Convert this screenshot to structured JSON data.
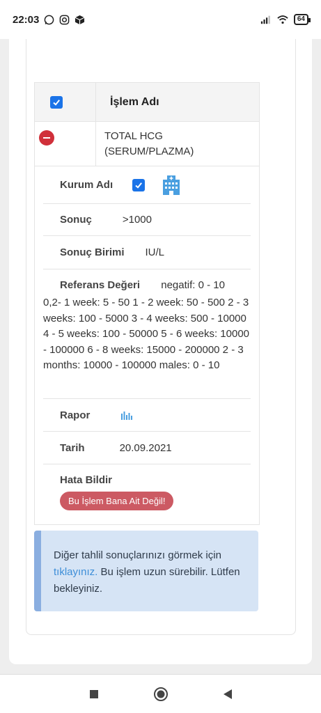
{
  "status_bar": {
    "time": "22:03",
    "battery": "64",
    "left_icons": [
      "whatsapp-icon",
      "instagram-icon",
      "package-icon"
    ],
    "right_icons": [
      "signal-icon",
      "wifi-icon",
      "battery-icon"
    ]
  },
  "table": {
    "header": {
      "name_label": "İşlem Adı"
    },
    "row": {
      "name_line1": "TOTAL HCG",
      "name_line2": "(SERUM/PLAZMA)"
    }
  },
  "details": {
    "kurum_label": "Kurum Adı",
    "sonuc_label": "Sonuç",
    "sonuc_value": ">1000",
    "birim_label": "Sonuç Birimi",
    "birim_value": "IU/L",
    "ref_label": "Referans Değeri",
    "ref_first": "negatif: 0 - 10",
    "ref_text": "0,2- 1 week: 5 - 50 1 - 2 week: 50 - 500 2 - 3 weeks: 100 - 5000 3 - 4 weeks: 500 - 10000 4 - 5 weeks: 100 - 50000 5 - 6 weeks: 10000 - 100000 6 - 8 weeks: 15000 - 200000 2 - 3 months: 10000 - 100000 males: 0 - 10",
    "rapor_label": "Rapor",
    "tarih_label": "Tarih",
    "tarih_value": "20.09.2021",
    "hata_label": "Hata Bildir",
    "hata_button": "Bu İşlem Bana Ait Değil!"
  },
  "info": {
    "text_before": "Diğer tahlil sonuçlarınızı görmek için ",
    "link_text": "tıklayınız.",
    "text_after": " Bu işlem uzun sürebilir. Lütfen bekleyiniz."
  },
  "colors": {
    "checkbox": "#1a73e8",
    "remove": "#d0303a",
    "report_button": "#cc5a63",
    "info_bg": "#d6e4f5",
    "info_border": "#8aaee0",
    "link": "#3d8ed8"
  }
}
